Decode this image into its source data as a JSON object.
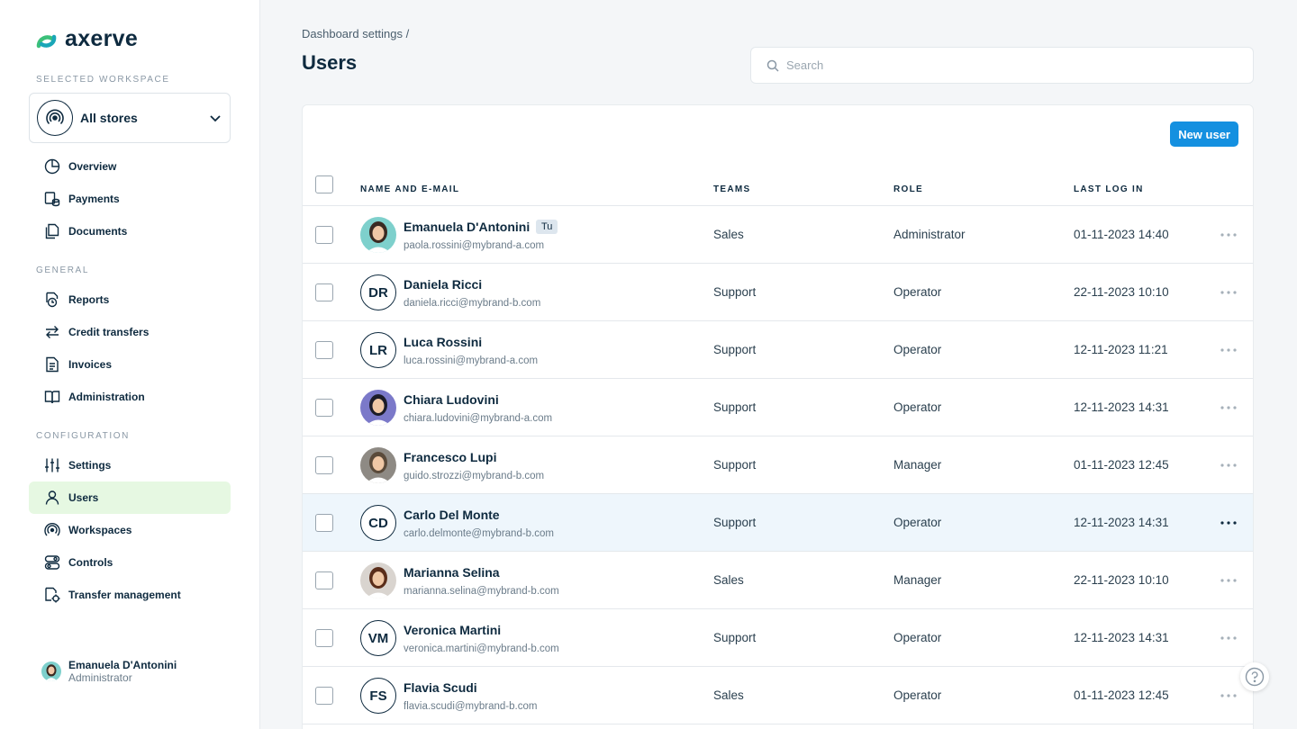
{
  "brand": {
    "name": "axerve",
    "accent": "#1490e0",
    "logo_green": "#3cc07a",
    "logo_teal": "#1aa6b7"
  },
  "sidebar": {
    "workspace_section_label": "SELECTED WORKSPACE",
    "workspace": {
      "label": "All stores",
      "icon": "broadcast-icon"
    },
    "general_label": "GENERAL",
    "config_label": "CONFIGURATION",
    "items": [
      {
        "label": "Overview",
        "icon": "pie-chart-icon"
      },
      {
        "label": "Payments",
        "icon": "payments-icon"
      },
      {
        "label": "Documents",
        "icon": "documents-icon"
      },
      {
        "label": "Reports",
        "icon": "reports-icon"
      },
      {
        "label": "Credit transfers",
        "icon": "transfer-arrows-icon"
      },
      {
        "label": "Invoices",
        "icon": "invoice-icon"
      },
      {
        "label": "Administration",
        "icon": "book-icon"
      },
      {
        "label": "Settings",
        "icon": "sliders-icon"
      },
      {
        "label": "Users",
        "icon": "user-icon",
        "active": true
      },
      {
        "label": "Workspaces",
        "icon": "workspaces-icon"
      },
      {
        "label": "Controls",
        "icon": "controls-icon"
      },
      {
        "label": "Transfer management",
        "icon": "transfer-management-icon"
      }
    ],
    "current_user": {
      "name": "Emanuela D'Antonini",
      "role": "Administrator"
    }
  },
  "header": {
    "breadcrumb": "Dashboard settings /",
    "title": "Users",
    "search_placeholder": "Search"
  },
  "table": {
    "new_user_label": "New user",
    "columns": [
      "NAME AND E-MAIL",
      "TEAMS",
      "ROLE",
      "LAST LOG IN"
    ],
    "rows": [
      {
        "name": "Emanuela D'Antonini",
        "badge": "Tu",
        "email": "paola.rossini@mybrand-a.com",
        "team": "Sales",
        "role": "Administrator",
        "last_login": "01-11-2023 14:40",
        "avatar": "photo",
        "photo_bg": "#7ed0cc",
        "photo_hair": "#3a2a22"
      },
      {
        "name": "Daniela Ricci",
        "email": "daniela.ricci@mybrand-b.com",
        "team": "Support",
        "role": "Operator",
        "last_login": "22-11-2023 10:10",
        "avatar": "initials",
        "initials": "DR"
      },
      {
        "name": "Luca Rossini",
        "email": "luca.rossini@mybrand-a.com",
        "team": "Support",
        "role": "Operator",
        "last_login": "12-11-2023 11:21",
        "avatar": "initials",
        "initials": "LR"
      },
      {
        "name": "Chiara Ludovini",
        "email": "chiara.ludovini@mybrand-a.com",
        "team": "Support",
        "role": "Operator",
        "last_login": "12-11-2023 14:31",
        "avatar": "photo",
        "photo_bg": "#7b79c9",
        "photo_hair": "#1c1c28"
      },
      {
        "name": "Francesco Lupi",
        "email": "guido.strozzi@mybrand-b.com",
        "team": "Support",
        "role": "Manager",
        "last_login": "01-11-2023 12:45",
        "avatar": "photo",
        "photo_bg": "#8e8a84",
        "photo_hair": "#5a4a3a"
      },
      {
        "name": "Carlo Del Monte",
        "email": "carlo.delmonte@mybrand-b.com",
        "team": "Support",
        "role": "Operator",
        "last_login": "12-11-2023 14:31",
        "avatar": "initials",
        "initials": "CD",
        "highlight": true
      },
      {
        "name": "Marianna Selina",
        "email": "marianna.selina@mybrand-b.com",
        "team": "Sales",
        "role": "Manager",
        "last_login": "22-11-2023 10:10",
        "avatar": "photo",
        "photo_bg": "#d9d4cf",
        "photo_hair": "#5a2d1a"
      },
      {
        "name": "Veronica Martini",
        "email": "veronica.martini@mybrand-b.com",
        "team": "Support",
        "role": "Operator",
        "last_login": "12-11-2023 14:31",
        "avatar": "initials",
        "initials": "VM"
      },
      {
        "name": "Flavia Scudi",
        "email": "flavia.scudi@mybrand-b.com",
        "team": "Sales",
        "role": "Operator",
        "last_login": "01-11-2023 12:45",
        "avatar": "initials",
        "initials": "FS"
      }
    ]
  }
}
